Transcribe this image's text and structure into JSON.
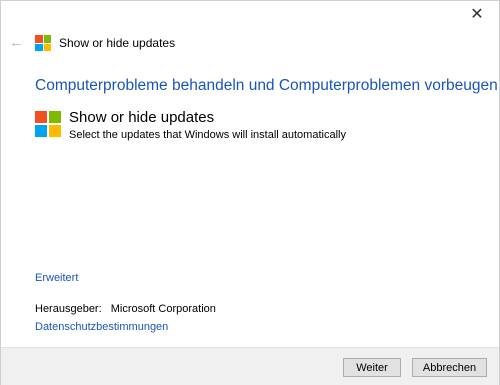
{
  "window": {
    "title": "Show or hide updates",
    "close_glyph": "✕",
    "back_glyph": "←"
  },
  "main": {
    "heading": "Computerprobleme behandeln und Computerproblemen vorbeugen",
    "item": {
      "title": "Show or hide updates",
      "description": "Select the updates that Windows will install automatically"
    },
    "advanced_link": "Erweitert",
    "publisher_label": "Herausgeber:",
    "publisher_value": "Microsoft Corporation",
    "privacy_link": "Datenschutzbestimmungen"
  },
  "footer": {
    "next_label": "Weiter",
    "cancel_label": "Abbrechen"
  },
  "colors": {
    "link": "#1a56b8",
    "logo_red": "#f25022",
    "logo_green": "#7fba00",
    "logo_blue": "#00a4ef",
    "logo_yellow": "#ffb900"
  }
}
